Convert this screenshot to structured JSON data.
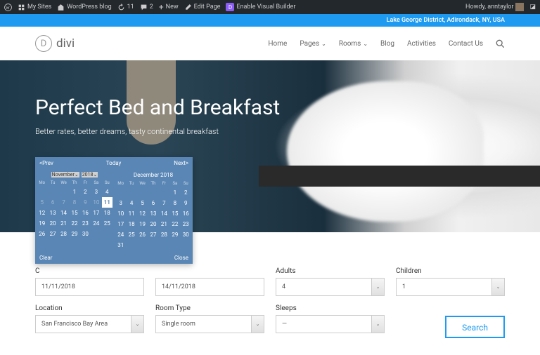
{
  "admin": {
    "mysites": "My Sites",
    "blog": "WordPress blog",
    "updates": "11",
    "comments": "2",
    "new": "New",
    "edit": "Edit Page",
    "builder": "Enable Visual Builder",
    "howdy": "Howdy, anntaylor"
  },
  "bluebar": "Lake George District, Adirondack, NY, USA",
  "logo": "divi",
  "nav": {
    "home": "Home",
    "pages": "Pages",
    "rooms": "Rooms",
    "blog": "Blog",
    "activities": "Activities",
    "contact": "Contact Us"
  },
  "hero": {
    "title": "Perfect Bed and Breakfast",
    "sub": "Better rates, better dreams, tasty continental breakfast"
  },
  "calendar": {
    "prev": "<Prev",
    "today": "Today",
    "next": "Next>",
    "clear": "Clear",
    "close": "Close",
    "month1": {
      "name": "November",
      "year": "2018",
      "dow": [
        "Mo",
        "Tu",
        "We",
        "Th",
        "Fr",
        "Sa",
        "Su"
      ],
      "rows": [
        [
          "",
          "",
          "",
          "1",
          "2",
          "3",
          "4"
        ],
        [
          "5",
          "6",
          "7",
          "8",
          "9",
          "10",
          "11"
        ],
        [
          "12",
          "13",
          "14",
          "15",
          "16",
          "17",
          "18"
        ],
        [
          "19",
          "20",
          "21",
          "22",
          "23",
          "24",
          "25"
        ],
        [
          "26",
          "27",
          "28",
          "29",
          "30",
          "",
          ""
        ]
      ],
      "dim": [
        [
          0,
          0,
          0,
          0,
          0,
          0,
          0
        ],
        [
          1,
          1,
          1,
          1,
          1,
          1,
          0
        ],
        [
          0,
          0,
          0,
          0,
          0,
          0,
          0
        ],
        [
          0,
          0,
          0,
          0,
          0,
          0,
          0
        ],
        [
          0,
          0,
          0,
          0,
          0,
          0,
          0
        ]
      ],
      "selected": "11"
    },
    "month2": {
      "name": "December 2018",
      "dow": [
        "Mo",
        "Tu",
        "We",
        "Th",
        "Fr",
        "Sa",
        "Su"
      ],
      "rows": [
        [
          "",
          "",
          "",
          "",
          "",
          "1",
          "2"
        ],
        [
          "3",
          "4",
          "5",
          "6",
          "7",
          "8",
          "9"
        ],
        [
          "10",
          "11",
          "12",
          "13",
          "14",
          "15",
          "16"
        ],
        [
          "17",
          "18",
          "19",
          "20",
          "21",
          "22",
          "23"
        ],
        [
          "24",
          "25",
          "26",
          "27",
          "28",
          "29",
          "30"
        ],
        [
          "31",
          "",
          "",
          "",
          "",
          "",
          ""
        ]
      ]
    }
  },
  "form": {
    "checkin": {
      "label": "C",
      "value": "11/11/2018"
    },
    "checkout": {
      "value": "14/11/2018"
    },
    "adults": {
      "label": "Adults",
      "value": "4"
    },
    "children": {
      "label": "Children",
      "value": "1"
    },
    "location": {
      "label": "Location",
      "value": "San Francisco Bay Area"
    },
    "roomtype": {
      "label": "Room Type",
      "value": "Single room"
    },
    "sleeps": {
      "label": "Sleeps",
      "value": "—"
    },
    "search": "Search"
  }
}
